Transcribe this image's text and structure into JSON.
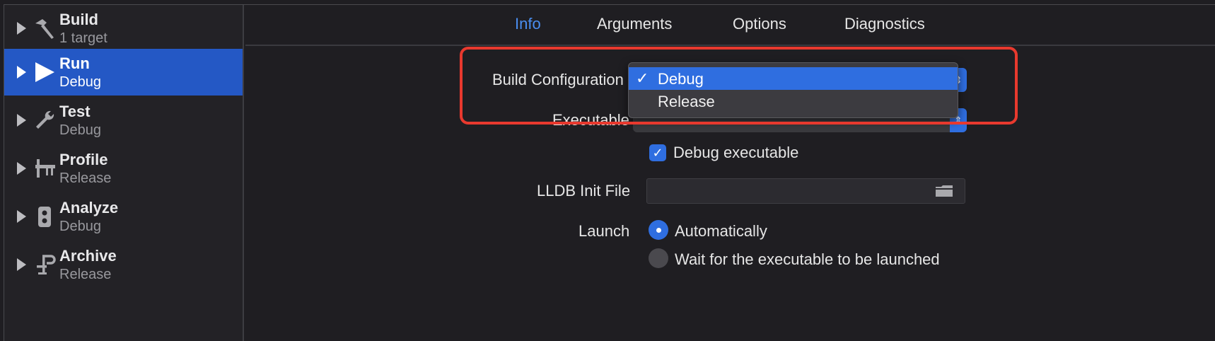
{
  "sidebar": {
    "items": [
      {
        "title": "Build",
        "subtitle": "1 target",
        "icon": "hammer-icon"
      },
      {
        "title": "Run",
        "subtitle": "Debug",
        "icon": "play-icon"
      },
      {
        "title": "Test",
        "subtitle": "Debug",
        "icon": "wrench-icon"
      },
      {
        "title": "Profile",
        "subtitle": "Release",
        "icon": "instruments-icon"
      },
      {
        "title": "Analyze",
        "subtitle": "Debug",
        "icon": "analyze-icon"
      },
      {
        "title": "Archive",
        "subtitle": "Release",
        "icon": "archive-icon"
      }
    ],
    "selected_index": 1
  },
  "tabs": [
    {
      "label": "Info",
      "active": true
    },
    {
      "label": "Arguments",
      "active": false
    },
    {
      "label": "Options",
      "active": false
    },
    {
      "label": "Diagnostics",
      "active": false
    }
  ],
  "form": {
    "build_configuration_label": "Build Configuration",
    "executable_label": "Executable",
    "debug_executable_label": "Debug executable",
    "debug_executable_checked": true,
    "lldb_label": "LLDB Init File",
    "lldb_value": "",
    "launch_label": "Launch",
    "launch_options": [
      {
        "label": "Automatically",
        "selected": true
      },
      {
        "label": "Wait for the executable to be launched",
        "selected": false
      }
    ]
  },
  "dropdown": {
    "options": [
      {
        "label": "Debug",
        "checked": true
      },
      {
        "label": "Release",
        "checked": false
      }
    ],
    "check_glyph": "✓"
  },
  "colors": {
    "accent": "#2f6ee0",
    "selection": "#2458c5",
    "annotation_red": "#e8392e",
    "active_tab": "#4a8ef0"
  }
}
